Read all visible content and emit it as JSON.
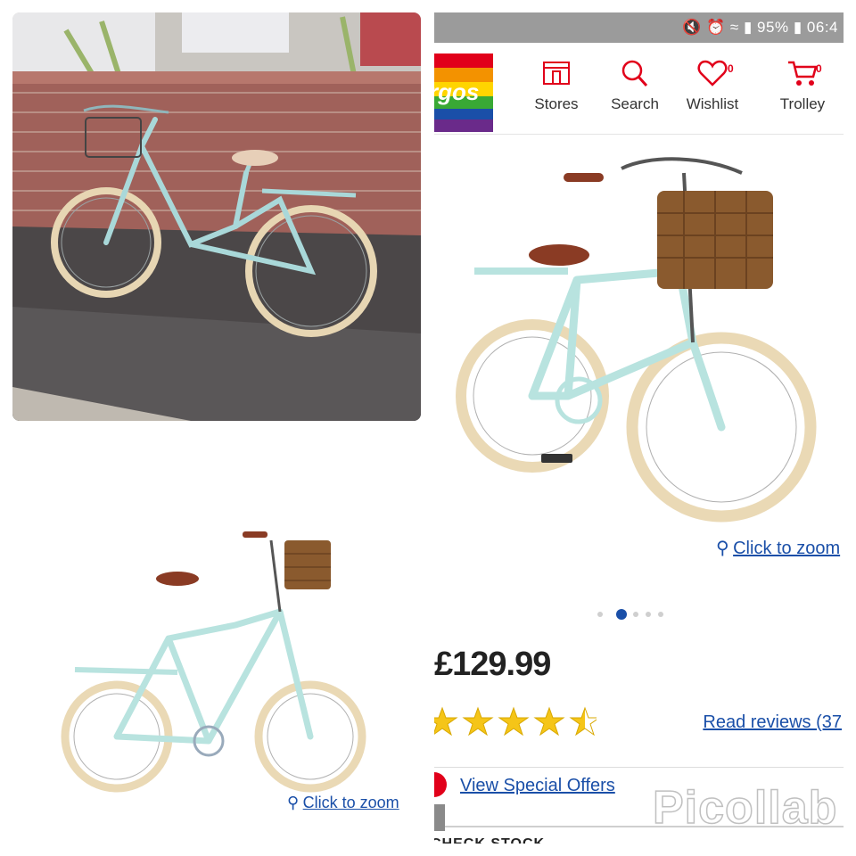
{
  "status_bar": {
    "battery": "95%",
    "time": "06:4"
  },
  "nav": {
    "logo_text": "rgos",
    "items": [
      {
        "label": "Stores",
        "icon": "store-icon"
      },
      {
        "label": "Search",
        "icon": "search-icon"
      },
      {
        "label": "Wishlist",
        "icon": "heart-icon",
        "count": "0"
      },
      {
        "label": "Trolley",
        "icon": "trolley-icon",
        "count": "0"
      }
    ]
  },
  "product": {
    "zoom_label": "Click to zoom",
    "price": "£129.99",
    "rating": 4.5,
    "reviews_label": "Read reviews (37",
    "offers_label": "View Special Offers",
    "check_stock_label": "CHECK STOCK",
    "image_dots": 5,
    "active_dot": 2
  },
  "left_product": {
    "zoom_label": "Click to zoom"
  },
  "watermark": "Picollab",
  "colors": {
    "frame": "#b8e3df",
    "tyre": "#ead9b5",
    "basket": "#8a5a2e",
    "saddle": "#8a3b24",
    "link": "#1a4fa8",
    "star": "#f5c518"
  }
}
